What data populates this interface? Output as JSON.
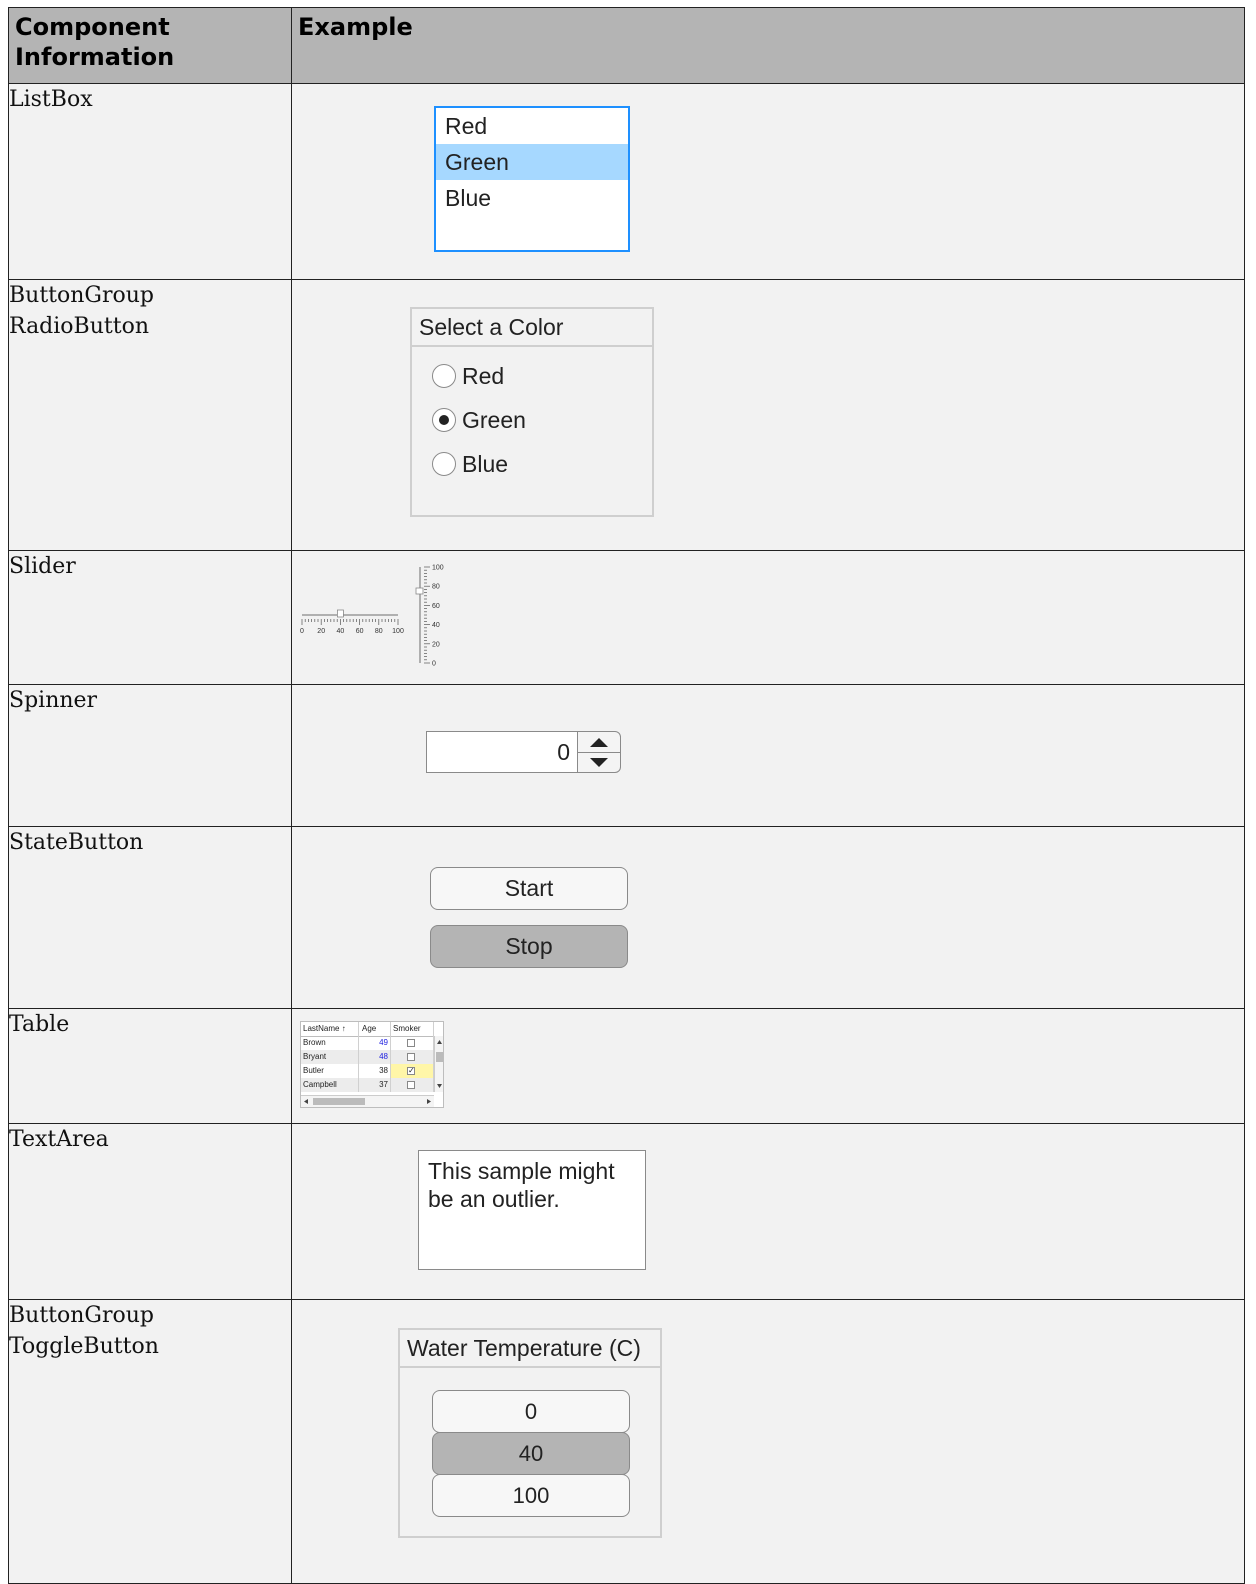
{
  "header": {
    "col1": "Component\nInformation",
    "col1_line1": "Component",
    "col1_line2": "Information",
    "col2": "Example"
  },
  "rows": {
    "listbox": {
      "name": "ListBox",
      "items": [
        "Red",
        "Green",
        "Blue"
      ],
      "selected": "Green",
      "colors": {
        "border": "#1e90ff",
        "selection": "#a6d8ff"
      }
    },
    "radio": {
      "name_line1": "ButtonGroup",
      "name_line2": "RadioButton",
      "group_title": "Select a Color",
      "options": [
        "Red",
        "Green",
        "Blue"
      ],
      "selected": "Green"
    },
    "slider": {
      "name": "Slider",
      "horizontal_ticks": [
        "0",
        "20",
        "40",
        "60",
        "80",
        "100"
      ],
      "vertical_ticks": [
        "100",
        "80",
        "60",
        "40",
        "20",
        "0"
      ],
      "horizontal_value": 40,
      "vertical_value": 75
    },
    "spinner": {
      "name": "Spinner",
      "value": "0"
    },
    "statebutton": {
      "name": "StateButton",
      "buttons": [
        "Start",
        "Stop"
      ],
      "pressed": "Stop"
    },
    "table": {
      "name": "Table",
      "columns": [
        "LastName",
        "Age",
        "Smoker"
      ],
      "sort_indicator": "↑",
      "rows": [
        {
          "name": "Brown",
          "age": "49",
          "smoker": false
        },
        {
          "name": "Bryant",
          "age": "48",
          "smoker": false
        },
        {
          "name": "Butler",
          "age": "38",
          "smoker": true
        },
        {
          "name": "Campbell",
          "age": "37",
          "smoker": false
        }
      ]
    },
    "textarea": {
      "name": "TextArea",
      "text": "This sample might\nbe an outlier."
    },
    "toggle": {
      "name_line1": "ButtonGroup",
      "name_line2": "ToggleButton",
      "group_title": "Water Temperature (C)",
      "buttons": [
        "0",
        "40",
        "100"
      ],
      "selected": "40"
    }
  }
}
